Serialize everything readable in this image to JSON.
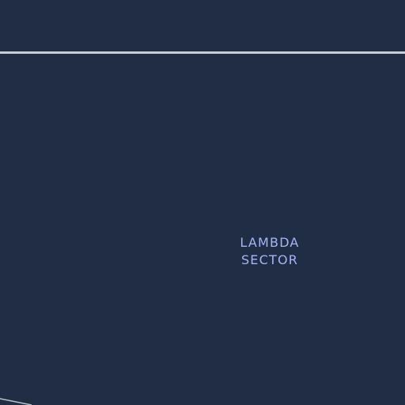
{
  "map": {
    "background_color": "#212d45",
    "road_color": "#c7cdd4",
    "label_color": "#a6b4f5",
    "sector_label": {
      "line1": "LAMBDA",
      "line2": "SECTOR"
    }
  }
}
